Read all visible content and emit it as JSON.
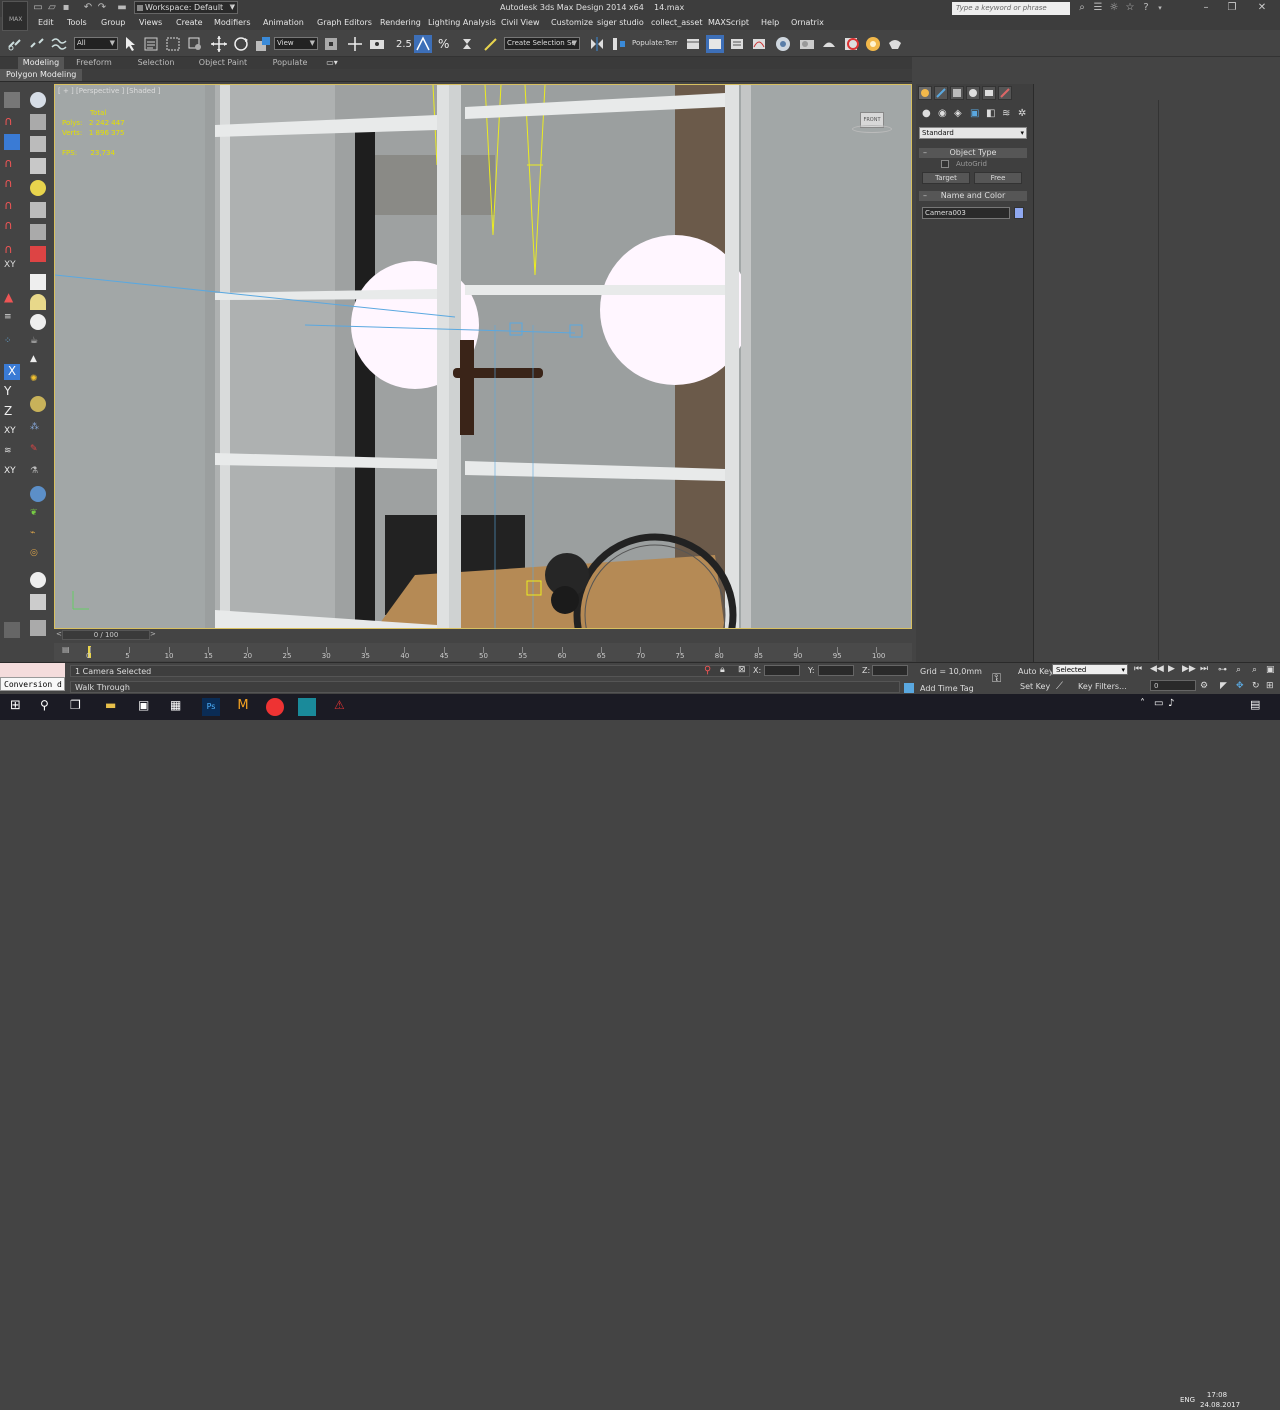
{
  "app": {
    "title": "Autodesk 3ds Max Design 2014 x64",
    "file": "14.max",
    "logo_text": "MAX",
    "workspace": "Workspace: Default",
    "search_placeholder": "Type a keyword or phrase"
  },
  "menu": [
    "Edit",
    "Tools",
    "Group",
    "Views",
    "Create",
    "Modifiers",
    "Animation",
    "Graph Editors",
    "Rendering",
    "Lighting Analysis",
    "Civil View",
    "Customize",
    "siger studio",
    "collect_asset",
    "MAXScript",
    "Help",
    "Ornatrix"
  ],
  "toolbar": {
    "selection_filter": "All",
    "ref_coord": "View",
    "snap_value": "2.5",
    "named_selection": "Create Selection Se",
    "populate": "Populate:Terr"
  },
  "ribbon": {
    "tabs": [
      "Modeling",
      "Freeform",
      "Selection",
      "Object Paint",
      "Populate"
    ],
    "active_tab": "Modeling",
    "sub": "Polygon Modeling"
  },
  "viewport": {
    "label": "[ + ] [Perspective ] [Shaded ]",
    "stats": {
      "total_label": "Total",
      "polys_label": "Polys:",
      "polys": "2 242 447",
      "verts_label": "Verts:",
      "verts": "1 896 375",
      "fps_label": "FPS:",
      "fps": "23,734"
    },
    "viewcube_label": "FRONT"
  },
  "command_panel": {
    "category": "Standard",
    "object_type_title": "Object Type",
    "autogrid": "AutoGrid",
    "buttons": [
      "Target",
      "Free"
    ],
    "name_color_title": "Name and Color",
    "object_name": "Camera003",
    "object_color": "#8fa8f0"
  },
  "timeline": {
    "slider": "0 / 100",
    "ticks": [
      "0",
      "5",
      "10",
      "15",
      "20",
      "25",
      "30",
      "35",
      "40",
      "45",
      "50",
      "55",
      "60",
      "65",
      "70",
      "75",
      "80",
      "85",
      "90",
      "95",
      "100"
    ]
  },
  "status": {
    "selection": "1 Camera Selected",
    "prompt": "Walk Through",
    "x_label": "X:",
    "y_label": "Y:",
    "z_label": "Z:",
    "grid": "Grid = 10,0mm",
    "add_time_tag": "Add Time Tag",
    "auto_key": "Auto Key",
    "set_key": "Set Key",
    "key_mode": "Selected",
    "key_filters": "Key Filters...",
    "frame": "0"
  },
  "maxscript": {
    "output": "Conversion d"
  },
  "taskbar": {
    "lang": "ENG",
    "time": "17:08",
    "date": "24.08.2017"
  }
}
